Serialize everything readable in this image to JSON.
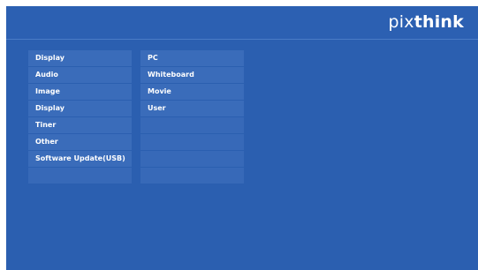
{
  "brand": {
    "logo_light": "pix",
    "logo_bold": "think"
  },
  "main_menu": {
    "items": [
      "Display",
      "Audio",
      "Image",
      "Display",
      "Tiner",
      "Other",
      "Software Update(USB)",
      ""
    ]
  },
  "sub_menu": {
    "items": [
      "PC",
      "Whiteboard",
      "Movie",
      "User",
      "",
      "",
      "",
      ""
    ]
  },
  "colors": {
    "background": "#2b5fb0",
    "menu_item": "#3a6cba",
    "text": "#ffffff"
  }
}
